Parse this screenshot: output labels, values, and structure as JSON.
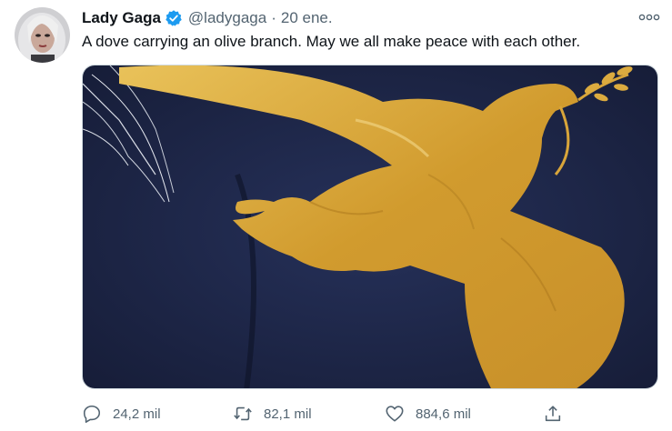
{
  "tweet": {
    "author_name": "Lady Gaga",
    "handle": "@ladygaga",
    "separator": "·",
    "date": "20 ene.",
    "text": "A dove carrying an olive branch. May we all make peace with each other."
  },
  "media": {
    "description_icon": "gold-dove-brooch-photo"
  },
  "actions": {
    "reply_count": "24,2 mil",
    "retweet_count": "82,1 mil",
    "like_count": "884,6 mil"
  },
  "colors": {
    "verified": "#1d9bf0",
    "icon": "#536471",
    "coat": "#1f2a4d",
    "gold": "#d4a236"
  }
}
